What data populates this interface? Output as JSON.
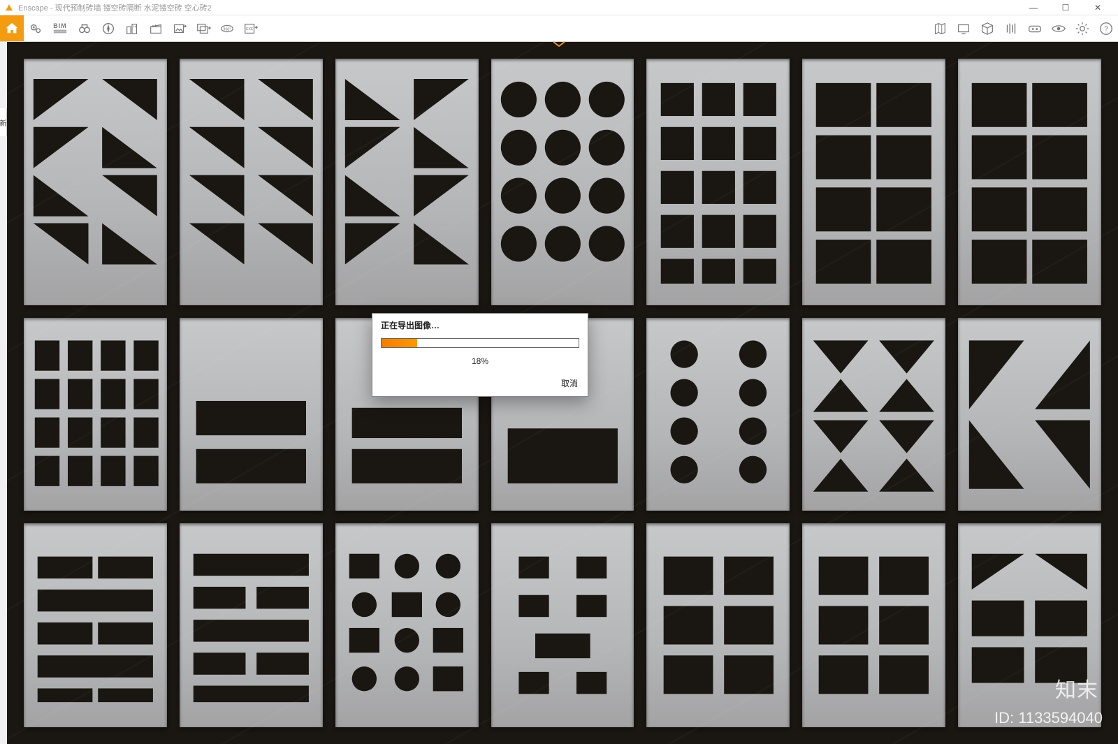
{
  "window": {
    "app_name": "Enscape",
    "document_title": "现代预制砖墙 镂空砖隔断 水泥镂空砖 空心砖2",
    "title_separator": " - "
  },
  "window_controls": {
    "minimize": "—",
    "maximize": "☐",
    "close": "✕"
  },
  "toolbar": {
    "left": [
      {
        "name": "home-icon",
        "label": "Home"
      },
      {
        "name": "location-icon",
        "label": "Location"
      },
      {
        "name": "bim-label",
        "label": "BIM"
      },
      {
        "name": "binoculars-icon",
        "label": "View"
      },
      {
        "name": "compass-icon",
        "label": "Orbit"
      },
      {
        "name": "buildings-icon",
        "label": "Assets"
      },
      {
        "name": "clapper-icon",
        "label": "Video"
      },
      {
        "name": "export-image-icon",
        "label": "Export Image"
      },
      {
        "name": "export-batch-icon",
        "label": "Batch"
      },
      {
        "name": "pano-360-icon",
        "label": "360°"
      },
      {
        "name": "export-exe-icon",
        "label": "EXE"
      }
    ],
    "right": [
      {
        "name": "map-icon",
        "label": "Map"
      },
      {
        "name": "display-icon",
        "label": "Display"
      },
      {
        "name": "cube-icon",
        "label": "3D"
      },
      {
        "name": "headset-lines-icon",
        "label": "Audio"
      },
      {
        "name": "vr-icon",
        "label": "VR"
      },
      {
        "name": "eye-icon",
        "label": "Visibility"
      },
      {
        "name": "settings-icon",
        "label": "Settings"
      },
      {
        "name": "help-icon",
        "label": "Help"
      }
    ]
  },
  "dialog": {
    "title": "正在导出图像…",
    "percent_text": "18%",
    "percent_value": 18,
    "cancel_label": "取消"
  },
  "watermark": {
    "brand": "知末",
    "id_label": "ID: 1133594040"
  },
  "left_crop_text": "新",
  "panels_description": "3 rows × 7 columns of precast concrete breeze-block wall samples with various cutout patterns (triangles, circles, squares, rectangles)."
}
